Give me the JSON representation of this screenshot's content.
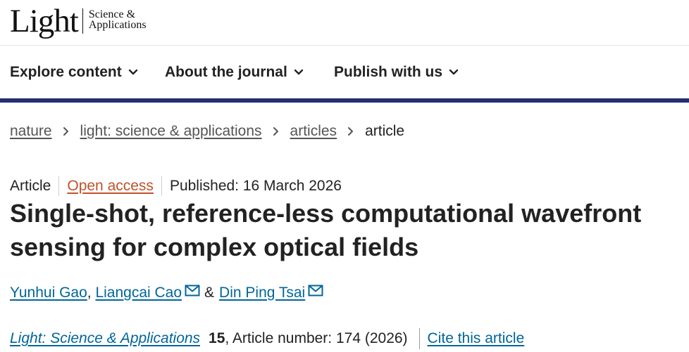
{
  "logo": {
    "main": "Light",
    "sub_line1": "Science &",
    "sub_line2": "Applications"
  },
  "nav": {
    "items": [
      {
        "label": "Explore content"
      },
      {
        "label": "About the journal"
      },
      {
        "label": "Publish with us"
      }
    ]
  },
  "breadcrumb": {
    "items": [
      {
        "label": "nature"
      },
      {
        "label": "light: science & applications"
      },
      {
        "label": "articles"
      },
      {
        "label": "article"
      }
    ]
  },
  "article": {
    "type": "Article",
    "access": "Open access",
    "published": "Published: 16 March 2026",
    "title": "Single-shot, reference-less computational wavefront sensing for complex optical fields",
    "authors": [
      {
        "name": "Yunhui Gao"
      },
      {
        "name": "Liangcai Cao"
      },
      {
        "name": "Din Ping Tsai"
      }
    ],
    "author_sep_1": ", ",
    "author_sep_2": "&",
    "journal": "Light: Science & Applications",
    "volume": "15",
    "article_number": ", Article number: 174 (2026)",
    "cite_label": "Cite this article"
  },
  "colors": {
    "accent_bar": "#222e6e",
    "link": "#006699",
    "open_access": "#c0522b"
  },
  "icons": {
    "chevron": "chevron-down-icon",
    "crumb_sep": "chevron-right-icon",
    "mail": "mail-icon"
  }
}
